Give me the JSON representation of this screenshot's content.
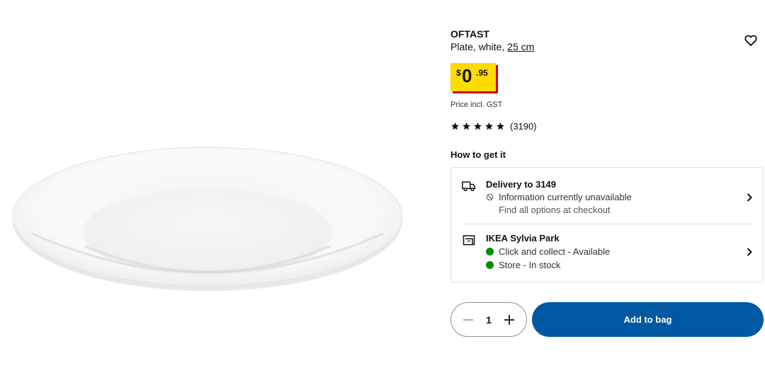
{
  "product": {
    "name": "OFTAST",
    "description_prefix": "Plate, white, ",
    "size": "25 cm",
    "image_alt_icon": "plate-image"
  },
  "price": {
    "currency": "$",
    "integer": "0",
    "decimal": ".95",
    "note": "Price incl. GST",
    "highlight_color": "#ffdb00",
    "shadow_color": "#cc0008"
  },
  "rating": {
    "stars": 5,
    "count": "(3190)"
  },
  "availability": {
    "heading": "How to get it",
    "delivery": {
      "title": "Delivery to 3149",
      "status": "Information currently unavailable",
      "note": "Find all options at checkout",
      "icon": "truck-icon"
    },
    "store": {
      "title": "IKEA Sylvia Park",
      "collect": "Click and collect - Available",
      "stock": "Store - In stock",
      "icon": "store-icon",
      "status_color": "#0a8a00"
    }
  },
  "cart": {
    "quantity": "1",
    "add_label": "Add to bag",
    "button_color": "#0058a3"
  }
}
